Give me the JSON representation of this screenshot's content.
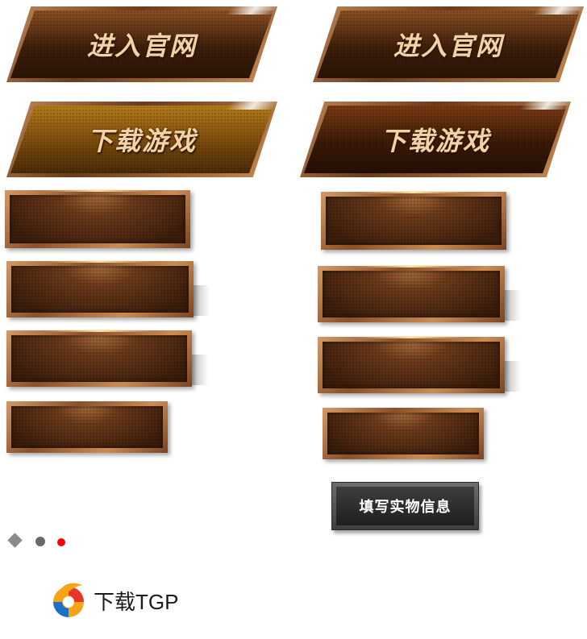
{
  "buttons": {
    "enter_site_label": "进入官网",
    "download_game_label": "下载游戏",
    "fill_info_label": "填写实物信息"
  },
  "tgp": {
    "label": "下载TGP"
  },
  "indicators": {
    "active_color": "#ff0000",
    "inactive_color": "#6a6a6a"
  }
}
